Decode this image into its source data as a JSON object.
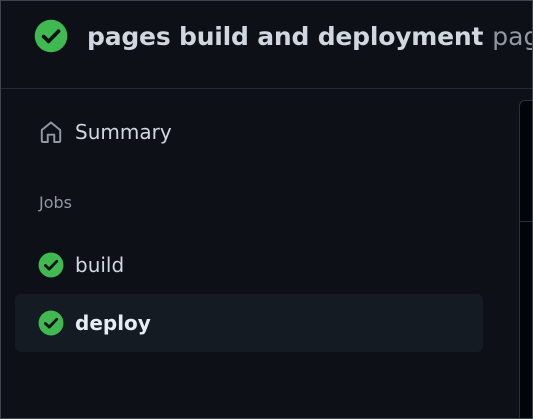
{
  "run": {
    "title": "pages build and deployment",
    "subtitle": "pag",
    "status_icon": "check-circle-fill-icon",
    "status_color": "#3fb950"
  },
  "sidebar": {
    "summary": {
      "label": "Summary",
      "icon": "home-icon"
    },
    "jobs_heading": "Jobs",
    "jobs": [
      {
        "label": "build",
        "status_icon": "check-circle-fill-icon",
        "status": "success",
        "selected": false
      },
      {
        "label": "deploy",
        "status_icon": "check-circle-fill-icon",
        "status": "success",
        "selected": true
      }
    ]
  },
  "colors": {
    "background": "#0d1117",
    "success": "#3fb950",
    "selected_row": "#151b23",
    "muted_text": "#9198a1"
  }
}
